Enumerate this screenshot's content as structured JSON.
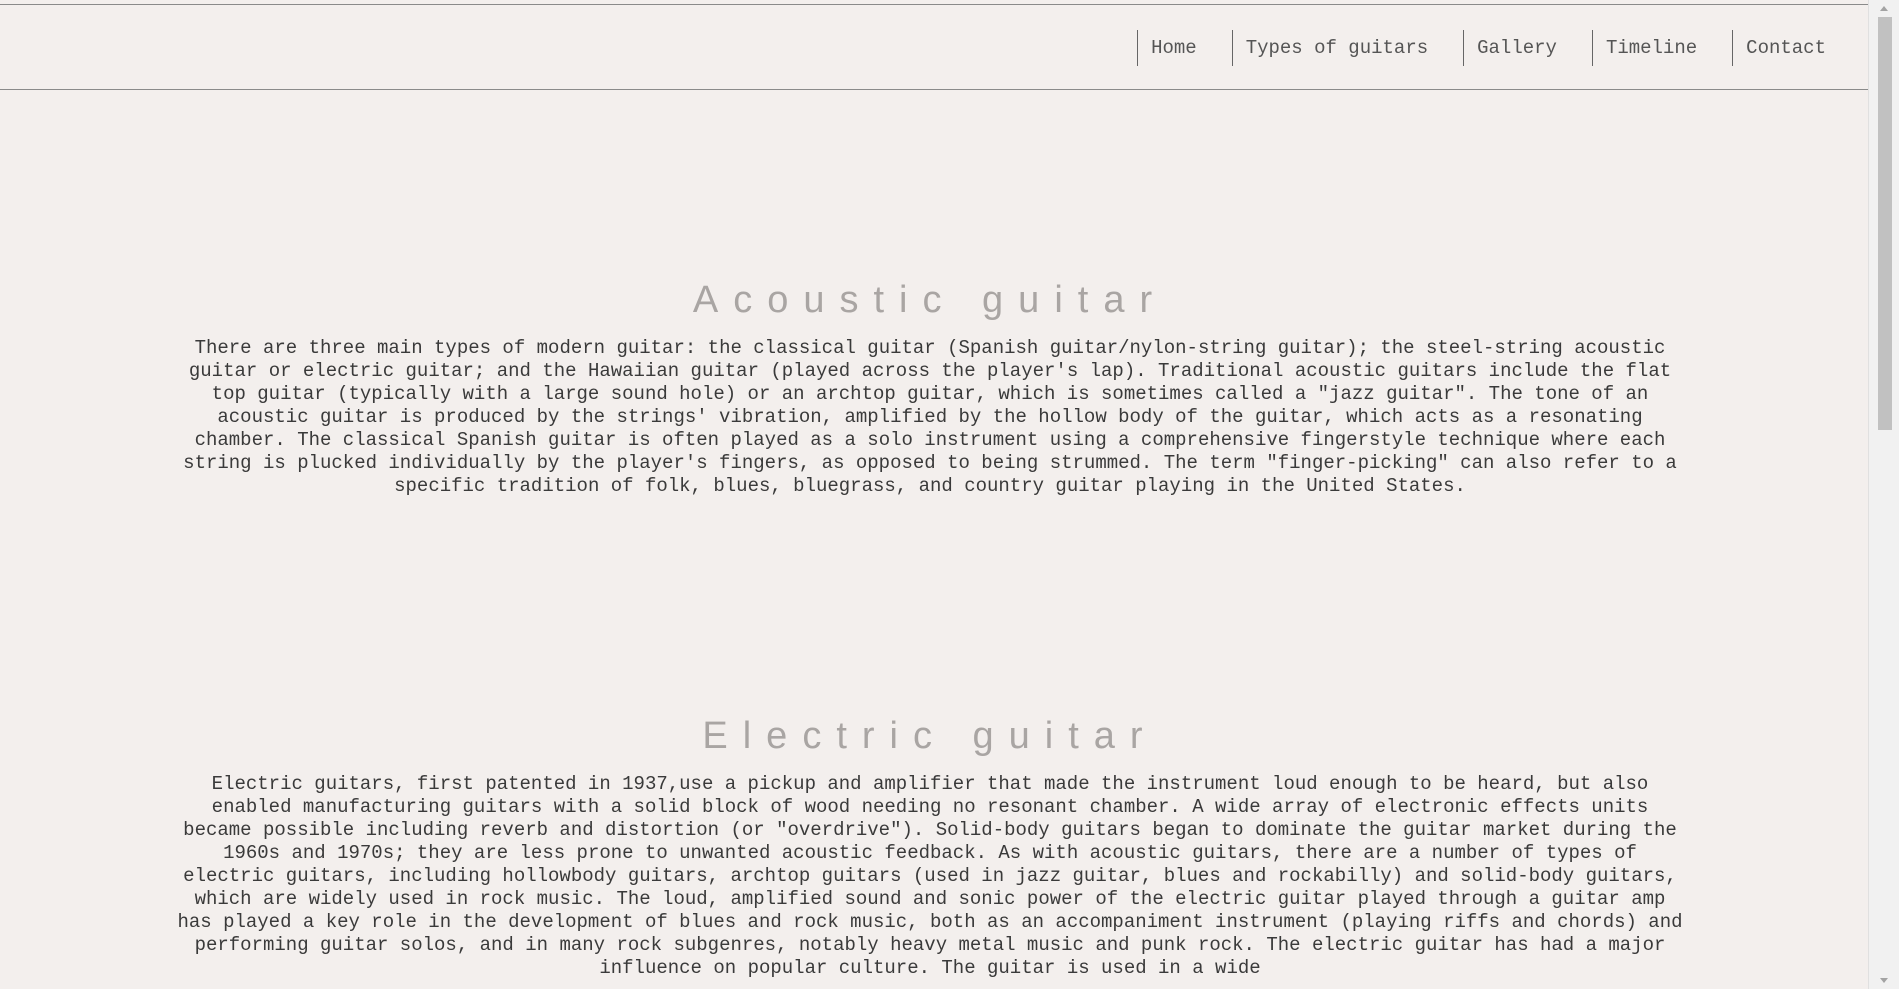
{
  "nav": {
    "items": [
      {
        "label": "Home"
      },
      {
        "label": "Types of guitars"
      },
      {
        "label": "Gallery"
      },
      {
        "label": "Timeline"
      },
      {
        "label": "Contact"
      }
    ]
  },
  "sections": {
    "acoustic": {
      "title": "Acoustic guitar",
      "body": "There are three main types of modern guitar: the classical guitar (Spanish guitar/nylon-string guitar); the steel-string acoustic guitar or electric guitar; and the Hawaiian guitar (played across the player's lap). Traditional acoustic guitars include the flat top guitar (typically with a large sound hole) or an archtop guitar, which is sometimes called a \"jazz guitar\". The tone of an acoustic guitar is produced by the strings' vibration, amplified by the hollow body of the guitar, which acts as a resonating chamber. The classical Spanish guitar is often played as a solo instrument using a comprehensive fingerstyle technique where each string is plucked individually by the player's fingers, as opposed to being strummed. The term \"finger-picking\" can also refer to a specific tradition of folk, blues, bluegrass, and country guitar playing in the United States."
    },
    "electric": {
      "title": "Electric guitar",
      "body": "Electric guitars, first patented in 1937,use a pickup and amplifier that made the instrument loud enough to be heard, but also enabled manufacturing guitars with a solid block of wood needing no resonant chamber. A wide array of electronic effects units became possible including reverb and distortion (or \"overdrive\"). Solid-body guitars began to dominate the guitar market during the 1960s and 1970s; they are less prone to unwanted acoustic feedback. As with acoustic guitars, there are a number of types of electric guitars, including hollowbody guitars, archtop guitars (used in jazz guitar, blues and rockabilly) and solid-body guitars, which are widely used in rock music. The loud, amplified sound and sonic power of the electric guitar played through a guitar amp has played a key role in the development of blues and rock music, both as an accompaniment instrument (playing riffs and chords) and performing guitar solos, and in many rock subgenres, notably heavy metal music and punk rock. The electric guitar has had a major influence on popular culture. The guitar is used in a wide"
    }
  },
  "scrollbar": {
    "position_fraction": 0.0,
    "visible_fraction": 0.43
  }
}
